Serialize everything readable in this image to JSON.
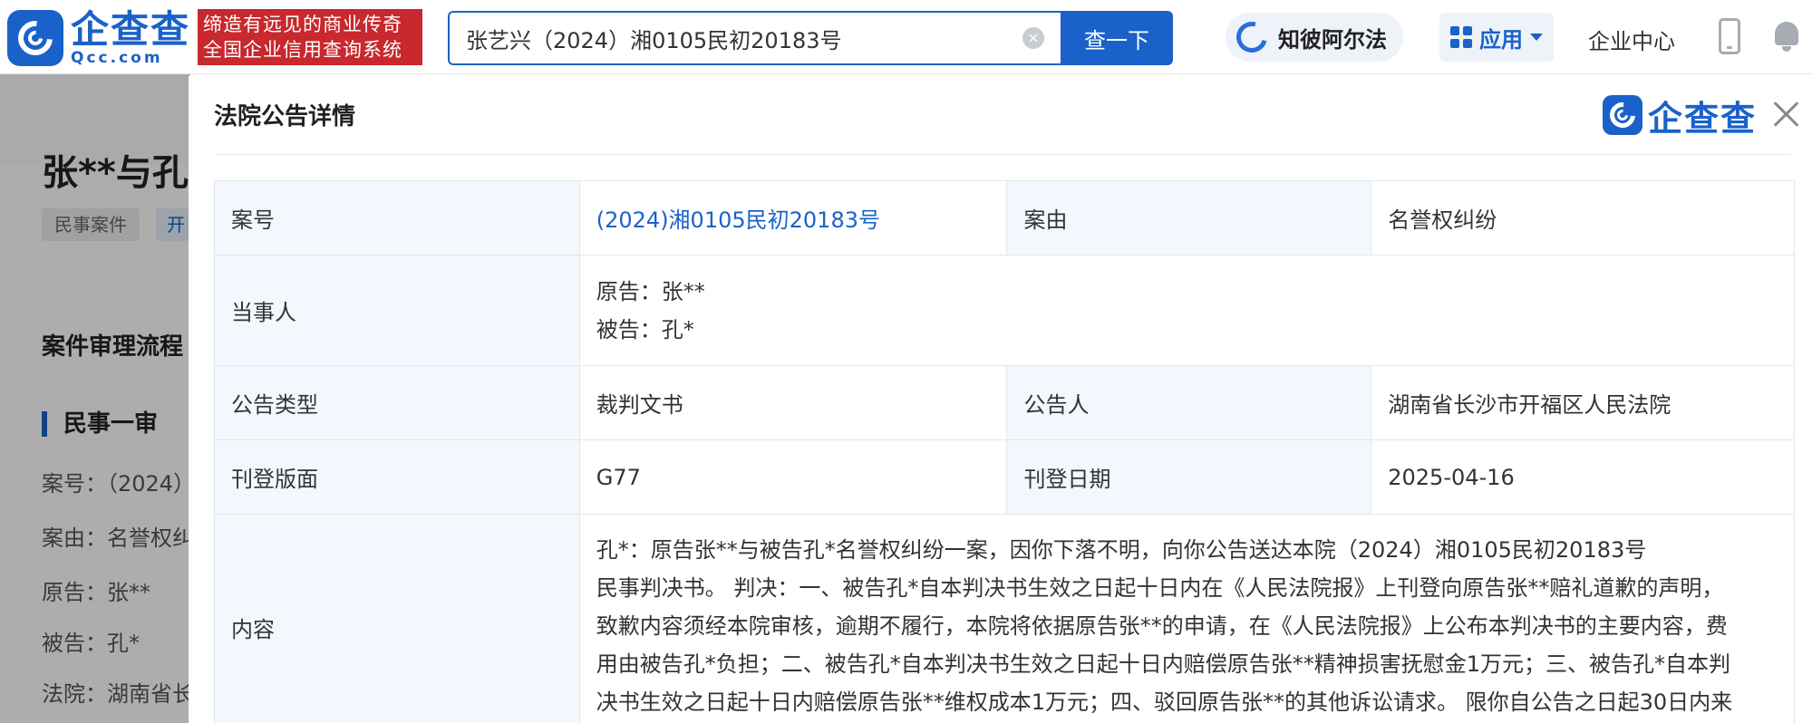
{
  "header": {
    "logo_cn": "企查查",
    "logo_en": "Qcc.com",
    "slogan_line1": "缔造有远见的商业传奇",
    "slogan_line2": "全国企业信用查询系统",
    "search_value": "张艺兴（2024）湘0105民初20183号",
    "clear_icon": "×",
    "search_button": "查一下",
    "zhibi_label": "知彼阿尔法",
    "apps_label": "应用",
    "enterprise_center": "企业中心"
  },
  "background": {
    "case_title": "张**与孔*",
    "tag_civil": "民事案件",
    "tag_second": "开",
    "process_title": "案件审理流程",
    "stage_title": "民事一审",
    "line_case_no": "案号：（2024）",
    "line_cause": "案由：名誉权纠",
    "line_plaintiff": "原告：张**",
    "line_defendant": "被告：孔*",
    "line_court": "法院：湖南省长"
  },
  "modal": {
    "title": "法院公告详情",
    "logo_text": "企查查",
    "rows": {
      "case_no_label": "案号",
      "case_no_value": "(2024)湘0105民初20183号",
      "cause_label": "案由",
      "cause_value": "名誉权纠纷",
      "parties_label": "当事人",
      "plaintiff": "原告：张**",
      "defendant": "被告：孔*",
      "type_label": "公告类型",
      "type_value": "裁判文书",
      "announcer_label": "公告人",
      "announcer_value": "湖南省长沙市开福区人民法院",
      "page_label": "刊登版面",
      "page_value": "G77",
      "date_label": "刊登日期",
      "date_value": "2025-04-16",
      "content_label": "内容",
      "content_line1": "孔*：原告张**与被告孔*名誉权纠纷一案，因你下落不明，向你公告送达本院（2024）湘0105民初20183号",
      "content_line2": "民事判决书。 判决：一、被告孔*自本判决书生效之日起十日内在《人民法院报》上刊登向原告张**赔礼道歉的声明，",
      "content_line3": "致歉内容须经本院审核，逾期不履行，本院将依据原告张**的申请，在《人民法院报》上公布本判决书的主要内容，费",
      "content_line4": "用由被告孔*负担；二、被告孔*自本判决书生效之日起十日内赔偿原告张**精神损害抚慰金1万元；三、被告孔*自本判",
      "content_line5": "决书生效之日起十日内赔偿原告张**维权成本1万元；四、驳回原告张**的其他诉讼请求。 限你自公告之日起30日内来"
    }
  },
  "colors": {
    "brand_blue": "#1a62c9",
    "slogan_red": "#c8282e",
    "key_cell_bg": "#f2f8fd"
  },
  "icons": [
    "logo-icon",
    "clear-icon",
    "zhibi-logo-icon",
    "grid-icon",
    "chevron-down-icon",
    "phone-icon",
    "bell-icon",
    "close-icon"
  ]
}
